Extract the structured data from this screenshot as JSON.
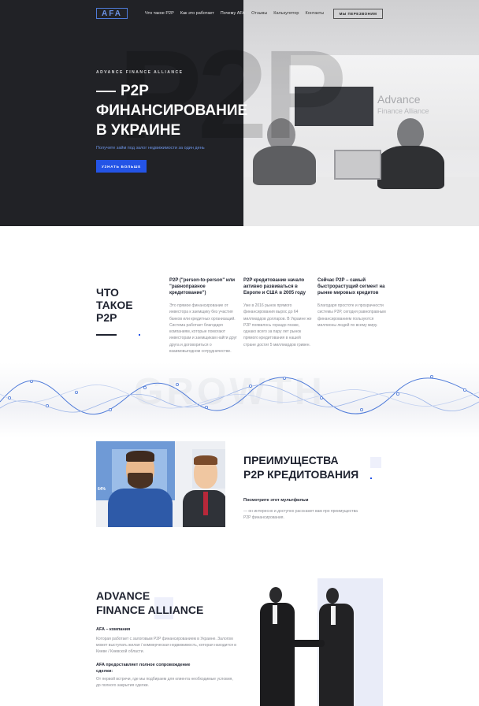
{
  "header": {
    "logo_text": "AFA",
    "nav": [
      "Что такое P2P",
      "Как это работает",
      "Почему AFA",
      "Отзывы",
      "Калькулятор",
      "Контакты"
    ],
    "callback_label": "МЫ ПЕРЕЗВОНИМ"
  },
  "hero": {
    "kicker": "ADVANCE FINANCE ALLIANCE",
    "title_line1": "P2P",
    "title_line2": "ФИНАНСИРОВАНИЕ",
    "title_line3": "В УКРАИНЕ",
    "subtitle": "Получите займ под залог недвижимости за один день",
    "button_label": "УЗНАТЬ БОЛЬШЕ",
    "background_text": "P2P",
    "sign_text": "Advance",
    "sign_subtext": "Finance Alliance"
  },
  "what": {
    "title_line1": "ЧТО",
    "title_line2": "ТАКОЕ",
    "title_line3": "P2P",
    "columns": [
      {
        "heading": "P2P (\"person-to-person\" или \"равноправное кредитование\")",
        "text": "Это прямое финансирование от инвестора к заемщику без участия банков или кредитных организаций. Система работает благодаря компаниям, которые помогают инвесторам и заемщикам найти друг друга и договориться о взаимовыгодном сотрудничестве."
      },
      {
        "heading": "P2P кредитование начало активно развиваться в Европе и США в 2005 году",
        "text": "Уже в 2016 рынок прямого финансирования вырос до 64 миллиардов долларов. В Украине же P2P появилось гораздо позже, однако всего за пару лет рынок прямого кредитования в нашей стране достиг 5 миллиардов гривен."
      },
      {
        "heading": "Сейчас P2P – самый быстрорастущий сегмент на рынке мировых кредитов",
        "text": "Благодаря простоте и прозрачности системы P2P, сегодня равноправным финансированием пользуются миллионы людей по всему миру."
      }
    ],
    "background_word": "GROWTH"
  },
  "advantages": {
    "title_line1": "ПРЕИМУЩЕСТВА",
    "title_line2": "P2P КРЕДИТОВАНИЯ",
    "subheading": "Посмотрите этот мультфильм",
    "text": "— он интересно и доступно расскажет вам про преимущества P2P финансирования.",
    "cartoon_percent": "64%"
  },
  "afa": {
    "title_line1": "ADVANCE",
    "title_line2": "FINANCE ALLIANCE",
    "heading1": "AFA – компания",
    "text1": "Которая работает с залоговым P2P финансированием в Украине. Залогом может выступать жилая / коммерческая недвижимость, которая находится в Киеве / Киевской области.",
    "heading2": "AFA предоставляет полное сопровождение сделки:",
    "text2": "От первой встречи, где мы подбираем для клиента необходимые условия, до полного закрытия сделки."
  },
  "colors": {
    "accent": "#2454e6",
    "dark": "#212226",
    "text": "#1f2330",
    "muted": "#8a8c93"
  }
}
